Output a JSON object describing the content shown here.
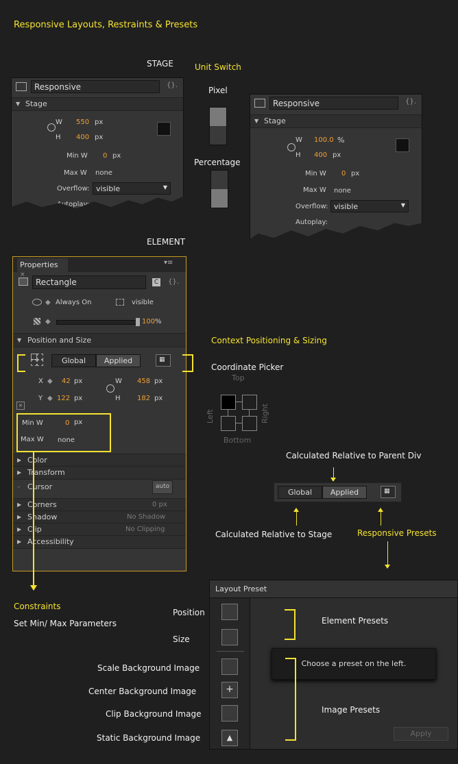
{
  "heading": "Responsive Layouts, Restraints & Presets",
  "labels": {
    "stage": "STAGE",
    "unit_switch": "Unit Switch",
    "pixel": "Pixel",
    "percentage": "Percentage",
    "element": "ELEMENT",
    "context": "Context Positioning & Sizing",
    "coordinate_picker": "Coordinate Picker",
    "top": "Top",
    "left": "Left",
    "right": "Right",
    "bottom": "Bottom",
    "calc_parent": "Calculated Relative to Parent Div",
    "calc_stage": "Calculated Relative to Stage",
    "responsive_presets": "Responsive Presets",
    "constraints": "Constraints",
    "set_minmax": "Set Min/ Max Parameters",
    "position": "Position",
    "size": "Size",
    "scale_bg": "Scale Background Image",
    "center_bg": "Center Background Image",
    "clip_bg": "Clip Background Image",
    "static_bg": "Static Background Image",
    "element_presets": "Element Presets",
    "image_presets": "Image Presets"
  },
  "stage_px": {
    "name": "Responsive",
    "section": "Stage",
    "w_label": "W",
    "w": "550",
    "w_unit": "px",
    "h_label": "H",
    "h": "400",
    "h_unit": "px",
    "minw_label": "Min W",
    "minw": "0",
    "minw_unit": "px",
    "maxw_label": "Max W",
    "maxw": "none",
    "overflow_label": "Overflow:",
    "overflow": "visible",
    "autoplay_label": "Autoplay:"
  },
  "stage_pct": {
    "name": "Responsive",
    "section": "Stage",
    "w_label": "W",
    "w": "100.0",
    "w_unit": "%",
    "h_label": "H",
    "h": "400",
    "h_unit": "px",
    "minw_label": "Min W",
    "minw": "0",
    "minw_unit": "px",
    "maxw_label": "Max W",
    "maxw": "none",
    "overflow_label": "Overflow:",
    "overflow": "visible",
    "autoplay_label": "Autoplay:"
  },
  "props": {
    "tab": "Properties",
    "name": "Rectangle",
    "always_on": "Always On",
    "visible": "visible",
    "opacity": "100",
    "opacity_unit": "%",
    "pos_size": "Position and Size",
    "global": "Global",
    "applied": "Applied",
    "x_label": "X",
    "x": "42",
    "x_unit": "px",
    "y_label": "Y",
    "y": "122",
    "y_unit": "px",
    "w_label": "W",
    "w": "458",
    "w_unit": "px",
    "h_label": "H",
    "h": "182",
    "h_unit": "px",
    "minw_label": "Min W",
    "minw": "0",
    "minw_unit": "px",
    "maxw_label": "Max W",
    "maxw": "none",
    "color": "Color",
    "transform": "Transform",
    "cursor": "Cursor",
    "cursor_value": "auto",
    "corners": "Corners",
    "corners_value": "0 px",
    "shadow": "Shadow",
    "shadow_value": "No Shadow",
    "clip": "Clip",
    "clip_value": "No Clipping",
    "accessibility": "Accessibility"
  },
  "toggle": {
    "global": "Global",
    "applied": "Applied"
  },
  "layout_preset": {
    "title": "Layout Preset",
    "message": "Choose a preset on the left.",
    "apply": "Apply"
  }
}
